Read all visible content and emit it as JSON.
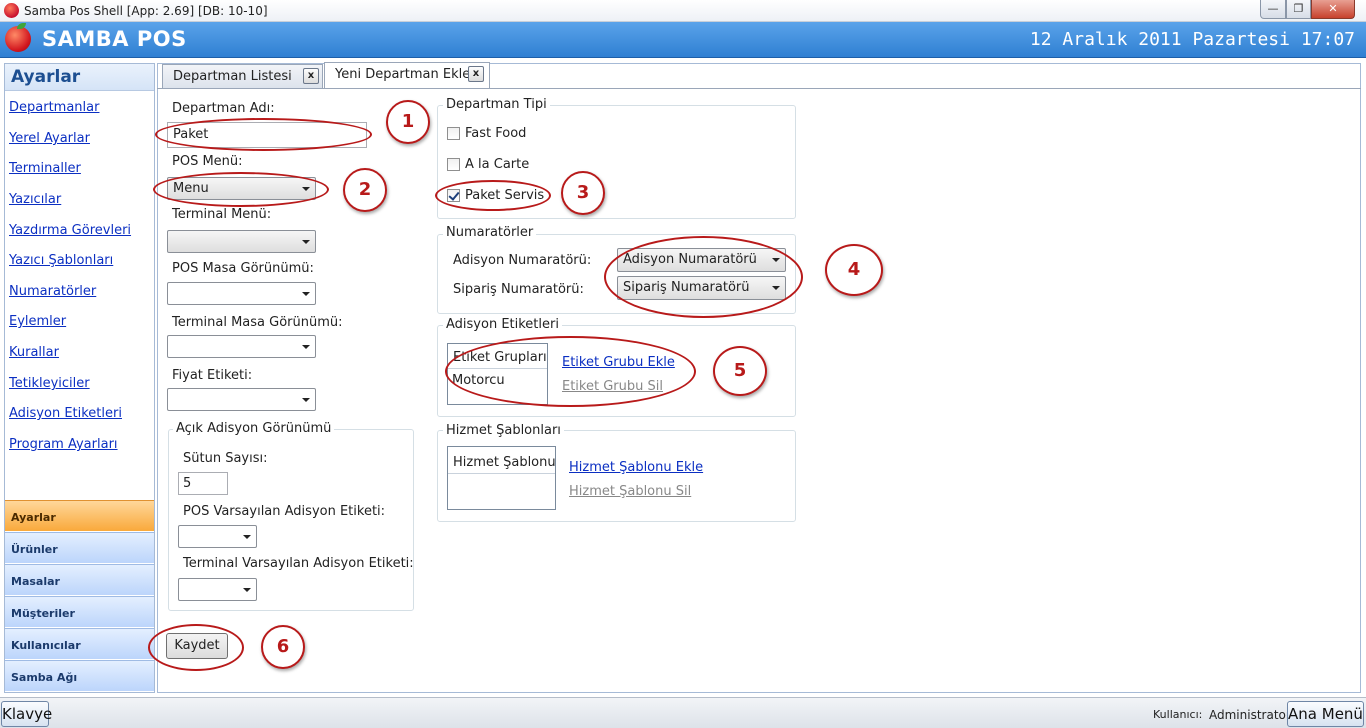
{
  "window": {
    "title": "Samba Pos Shell [App: 2.69] [DB: 10-10]"
  },
  "header": {
    "brand": "SAMBA POS",
    "datetime": "12 Aralık 2011 Pazartesi 17:07"
  },
  "sidebar": {
    "title": "Ayarlar",
    "links": [
      "Departmanlar",
      "Yerel Ayarlar",
      "Terminaller",
      "Yazıcılar",
      "Yazdırma Görevleri",
      "Yazıcı Şablonları",
      "Numaratörler",
      "Eylemler",
      "Kurallar",
      "Tetikleyiciler",
      "Adisyon Etiketleri",
      "Program Ayarları"
    ],
    "sections": [
      "Ayarlar",
      "Ürünler",
      "Masalar",
      "Müşteriler",
      "Kullanıcılar",
      "Samba Ağı"
    ],
    "active_section": "Ayarlar"
  },
  "tabs": [
    {
      "label": "Departman Listesi",
      "close": "x"
    },
    {
      "label": "Yeni Departman Ekle",
      "close": "x"
    }
  ],
  "form": {
    "department_name_label": "Departman Adı:",
    "department_name_value": "Paket",
    "pos_menu_label": "POS Menü:",
    "pos_menu_value": "Menu",
    "terminal_menu_label": "Terminal Menü:",
    "pos_table_view_label": "POS Masa Görünümü:",
    "terminal_table_view_label": "Terminal Masa Görünümü:",
    "price_tag_label": "Fiyat Etiketi:",
    "open_ticket_group": {
      "title": "Açık Adisyon Görünümü",
      "column_count_label": "Sütun Sayısı:",
      "column_count_value": "5",
      "pos_default_tag_label": "POS Varsayılan Adisyon Etiketi:",
      "terminal_default_tag_label": "Terminal Varsayılan Adisyon Etiketi:"
    },
    "save_label": "Kaydet"
  },
  "department_type": {
    "title": "Departman Tipi",
    "options": [
      {
        "label": "Fast Food",
        "checked": false
      },
      {
        "label": "A la Carte",
        "checked": false
      },
      {
        "label": "Paket Servis",
        "checked": true
      }
    ]
  },
  "numerators": {
    "title": "Numaratörler",
    "ticket_label": "Adisyon Numaratörü:",
    "ticket_value": "Adisyon Numaratörü",
    "order_label": "Sipariş Numaratörü:",
    "order_value": "Sipariş Numaratörü"
  },
  "ticket_tags": {
    "title": "Adisyon Etiketleri",
    "list_header": "Etiket Grupları",
    "items": [
      "Motorcu"
    ],
    "add_link": "Etiket Grubu Ekle",
    "remove_link": "Etiket Grubu Sil"
  },
  "service_templates": {
    "title": "Hizmet Şablonları",
    "list_header": "Hizmet Şablonu",
    "add_link": "Hizmet Şablonu Ekle",
    "remove_link": "Hizmet Şablonu Sil"
  },
  "annotations": [
    "1",
    "2",
    "3",
    "4",
    "5",
    "6"
  ],
  "statusbar": {
    "keyboard_label": "Klavye",
    "user_label": "Kullanıcı:",
    "user_value": "Administrator",
    "main_menu_label": "Ana Menü"
  },
  "colors": {
    "header": "#3b8bdc",
    "link": "#0b2fc2",
    "annotation": "#b81a1a",
    "active_nav": "#f9a93b"
  }
}
